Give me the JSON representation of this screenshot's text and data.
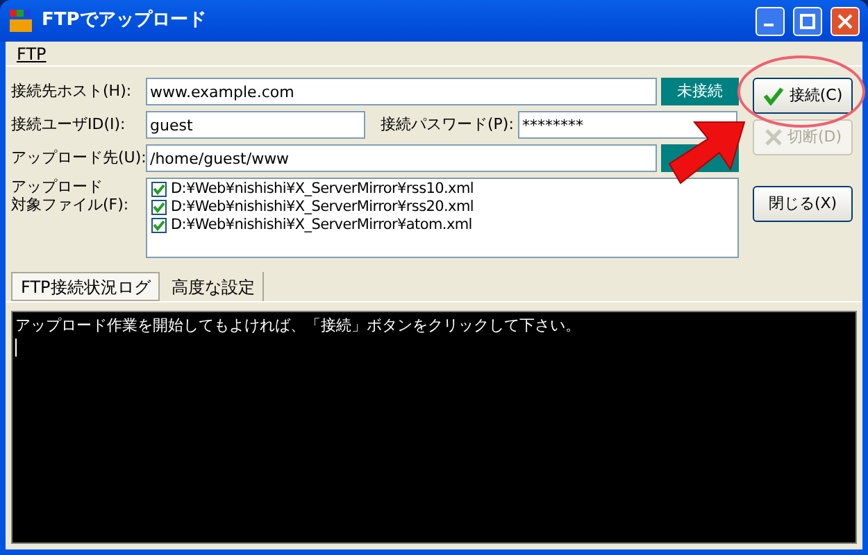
{
  "window": {
    "title": "FTPでアップロード"
  },
  "menu": [
    "FTP"
  ],
  "host": {
    "label": "接続先ホスト(H):",
    "value": "www.example.com",
    "status": "未接続"
  },
  "user": {
    "label": "接続ユーザID(I):",
    "value": "guest"
  },
  "password": {
    "label": "接続パスワード(P):",
    "value": "********"
  },
  "upload_dir": {
    "label": "アップロード先(U):",
    "value": "/home/guest/www"
  },
  "files": {
    "label": [
      "アップロード",
      "対象ファイル(F):"
    ],
    "items": [
      {
        "path": "D:¥Web¥nishishi¥X_ServerMirror¥rss10.xml",
        "checked": true
      },
      {
        "path": "D:¥Web¥nishishi¥X_ServerMirror¥rss20.xml",
        "checked": true
      },
      {
        "path": "D:¥Web¥nishishi¥X_ServerMirror¥atom.xml",
        "checked": true
      }
    ]
  },
  "buttons": [
    {
      "label": "接続(C)",
      "kind": "connect",
      "disabled": false
    },
    {
      "label": "切断(D)",
      "kind": "disconnect",
      "disabled": true
    },
    {
      "label": "閉じる(X)",
      "kind": "close",
      "disabled": false
    }
  ],
  "tabs": [
    {
      "label": "FTP接続状況ログ",
      "selected": true
    },
    {
      "label": "高度な設定",
      "selected": false
    }
  ],
  "log": "アップロード作業を開始してもよければ、「接続」ボタンをクリックして下さい。"
}
